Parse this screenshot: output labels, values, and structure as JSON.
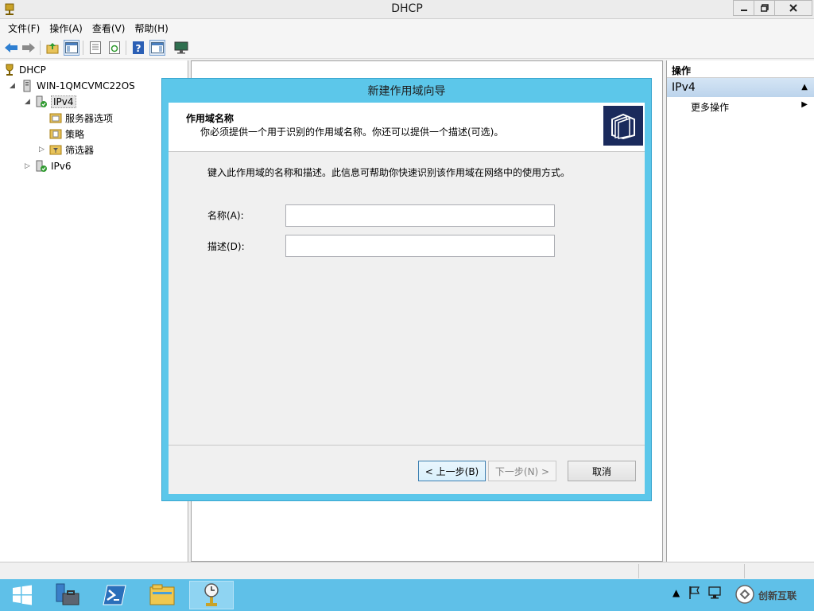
{
  "window": {
    "title": "DHCP"
  },
  "menu": [
    "文件(F)",
    "操作(A)",
    "查看(V)",
    "帮助(H)"
  ],
  "toolbar_icons": [
    "back-arrow-icon",
    "forward-arrow-icon",
    "up-folder-icon",
    "show-tree-icon",
    "properties-icon",
    "refresh-icon",
    "help-icon",
    "action-pane-icon",
    "monitor-icon"
  ],
  "tree": {
    "root": "DHCP",
    "server": "WIN-1QMCVMC22OS",
    "ipv4": "IPv4",
    "ipv4_children": [
      "服务器选项",
      "策略",
      "筛选器"
    ],
    "ipv6": "IPv6"
  },
  "actions": {
    "header": "操作",
    "section": "IPv4",
    "more": "更多操作"
  },
  "dialog": {
    "title": "新建作用域向导",
    "heading": "作用域名称",
    "subheading": "你必须提供一个用于识别的作用域名称。你还可以提供一个描述(可选)。",
    "instruction": "键入此作用域的名称和描述。此信息可帮助你快速识别该作用域在网络中的使用方式。",
    "name_label": "名称(A):",
    "name_value": "",
    "desc_label": "描述(D):",
    "desc_value": "",
    "back_label": "< 上一步(B)",
    "next_label": "下一步(N) >",
    "cancel_label": "取消"
  },
  "watermark": "创新互联",
  "colors": {
    "dialog_frame": "#5cc7ea",
    "taskbar": "#5fc0e8",
    "actions_section": "#c8dcf0"
  }
}
